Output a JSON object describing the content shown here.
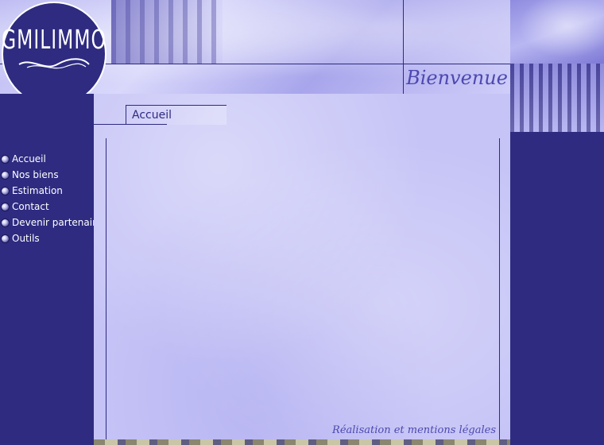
{
  "logo": {
    "text": "GMILIMMO"
  },
  "header": {
    "welcome": "Bienvenue"
  },
  "nav": {
    "items": [
      {
        "label": "Accueil"
      },
      {
        "label": "Nos biens"
      },
      {
        "label": "Estimation"
      },
      {
        "label": "Contact"
      },
      {
        "label": "Devenir partenaire"
      },
      {
        "label": "Outils"
      }
    ]
  },
  "main": {
    "page_title": "Accueil"
  },
  "footer": {
    "link": "Réalisation et mentions légales"
  },
  "colors": {
    "primary": "#2e2b80",
    "background": "#c6c4f6",
    "accent": "#4d48b0"
  }
}
